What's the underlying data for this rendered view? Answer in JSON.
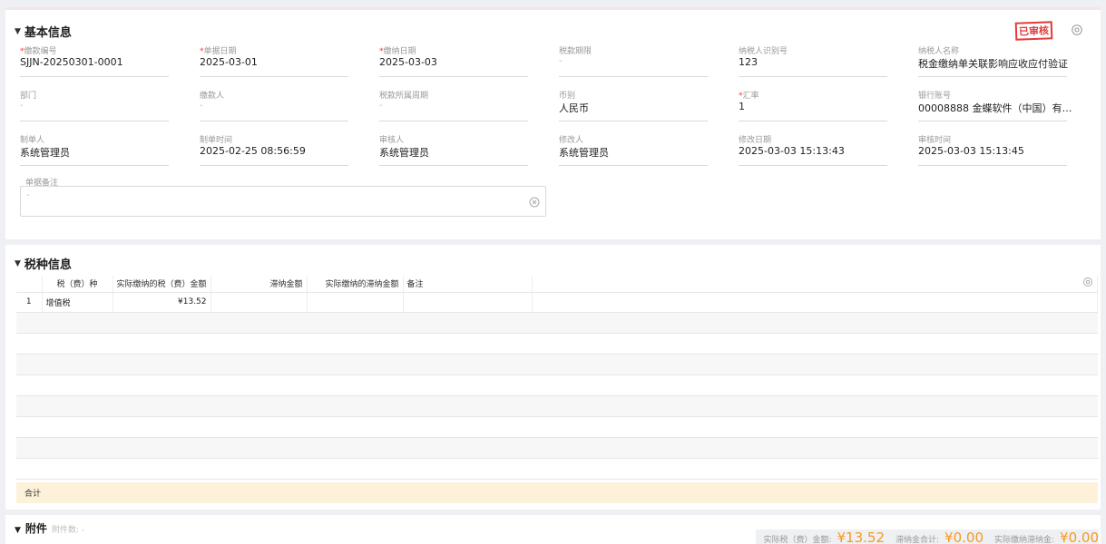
{
  "basic": {
    "title": "基本信息",
    "status_stamp": "已审核",
    "fields": [
      {
        "label": "缴款编号",
        "required": true,
        "value": "SJJN-20250301-0001"
      },
      {
        "label": "单据日期",
        "required": true,
        "value": "2025-03-01"
      },
      {
        "label": "缴纳日期",
        "required": true,
        "value": "2025-03-03"
      },
      {
        "label": "税款期限",
        "required": false,
        "value": "-"
      },
      {
        "label": "纳税人识别号",
        "required": false,
        "value": "123"
      },
      {
        "label": "纳税人名称",
        "required": false,
        "value": "税金缴纳单关联影响应收应付验证"
      },
      {
        "label": "部门",
        "required": false,
        "value": "-"
      },
      {
        "label": "缴款人",
        "required": false,
        "value": "-"
      },
      {
        "label": "税款所属周期",
        "required": false,
        "value": "-"
      },
      {
        "label": "币别",
        "required": false,
        "value": "人民币"
      },
      {
        "label": "汇率",
        "required": true,
        "value": "1"
      },
      {
        "label": "银行账号",
        "required": false,
        "value": "00008888 金蝶软件（中国）有限公..."
      },
      {
        "label": "制单人",
        "required": false,
        "value": "系统管理员"
      },
      {
        "label": "制单时间",
        "required": false,
        "value": "2025-02-25 08:56:59"
      },
      {
        "label": "审核人",
        "required": false,
        "value": "系统管理员"
      },
      {
        "label": "修改人",
        "required": false,
        "value": "系统管理员"
      },
      {
        "label": "修改日期",
        "required": false,
        "value": "2025-03-03 15:13:43"
      },
      {
        "label": "审核时间",
        "required": false,
        "value": "2025-03-03 15:13:45"
      }
    ],
    "remark_label": "单据备注",
    "remark_value": "-"
  },
  "tax": {
    "title": "税种信息",
    "columns": [
      "税（费）种",
      "实际缴纳的税（费）金额",
      "滞纳金额",
      "实际缴纳的滞纳金额",
      "备注"
    ],
    "rows": [
      {
        "index": "1",
        "tax_type": "增值税",
        "amount": "¥13.52",
        "late_fee": "",
        "actual_late_fee": "",
        "remark": ""
      }
    ],
    "total_label": "合计"
  },
  "attachments": {
    "title": "附件",
    "count_label": "附件数: -"
  },
  "summary": {
    "actual_tax_label": "实际税（费）金额:",
    "actual_tax_value": "¥13.52",
    "late_fee_total_label": "滞纳金合计:",
    "late_fee_total_value": "¥0.00",
    "actual_late_fee_label": "实际缴纳滞纳金:",
    "actual_late_fee_value": "¥0.00"
  },
  "colors": {
    "accent_orange": "#f59a23",
    "stamp_red": "#e23a3a",
    "total_row_bg": "#fdf1d9"
  }
}
